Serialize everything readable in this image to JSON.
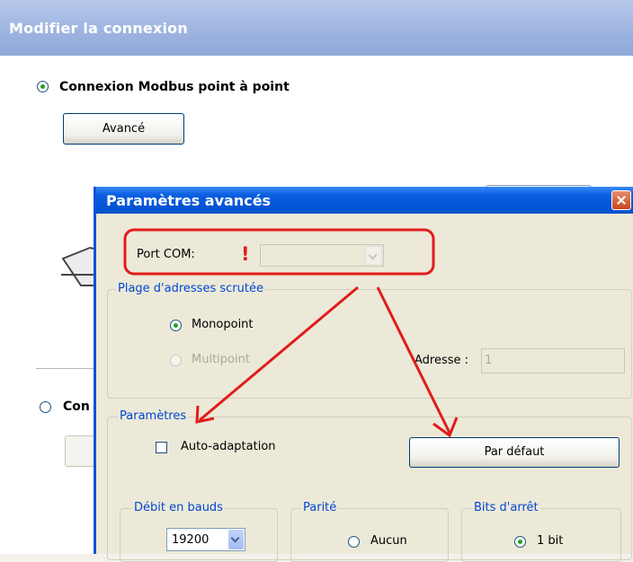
{
  "window": {
    "title": "Modifier la connexion"
  },
  "connection": {
    "option1_label": "Connexion Modbus point à point",
    "advanced_button": "Avancé",
    "option2_label_partial": "Con"
  },
  "dialog": {
    "title": "Paramètres avancés",
    "port_label": "Port COM:",
    "port_value": "",
    "warning_symbol": "!",
    "scan_group": {
      "label": "Plage d'adresses scrutée",
      "monopoint": "Monopoint",
      "multipoint": "Multipoint",
      "address_label": "Adresse :",
      "address_value": "1"
    },
    "params_group": {
      "label": "Paramètres",
      "auto_adapt": "Auto-adaptation",
      "default_button": "Par défaut"
    },
    "baud_group": {
      "label": "Débit en bauds",
      "value": "19200"
    },
    "parity_group": {
      "label": "Parité",
      "option_none": "Aucun"
    },
    "stop_group": {
      "label": "Bits d'arrêt",
      "option_1bit": "1 bit"
    }
  },
  "colors": {
    "annotation": "#e21b1b",
    "title_blue": "#0454d8",
    "group_label": "#0046d5"
  }
}
